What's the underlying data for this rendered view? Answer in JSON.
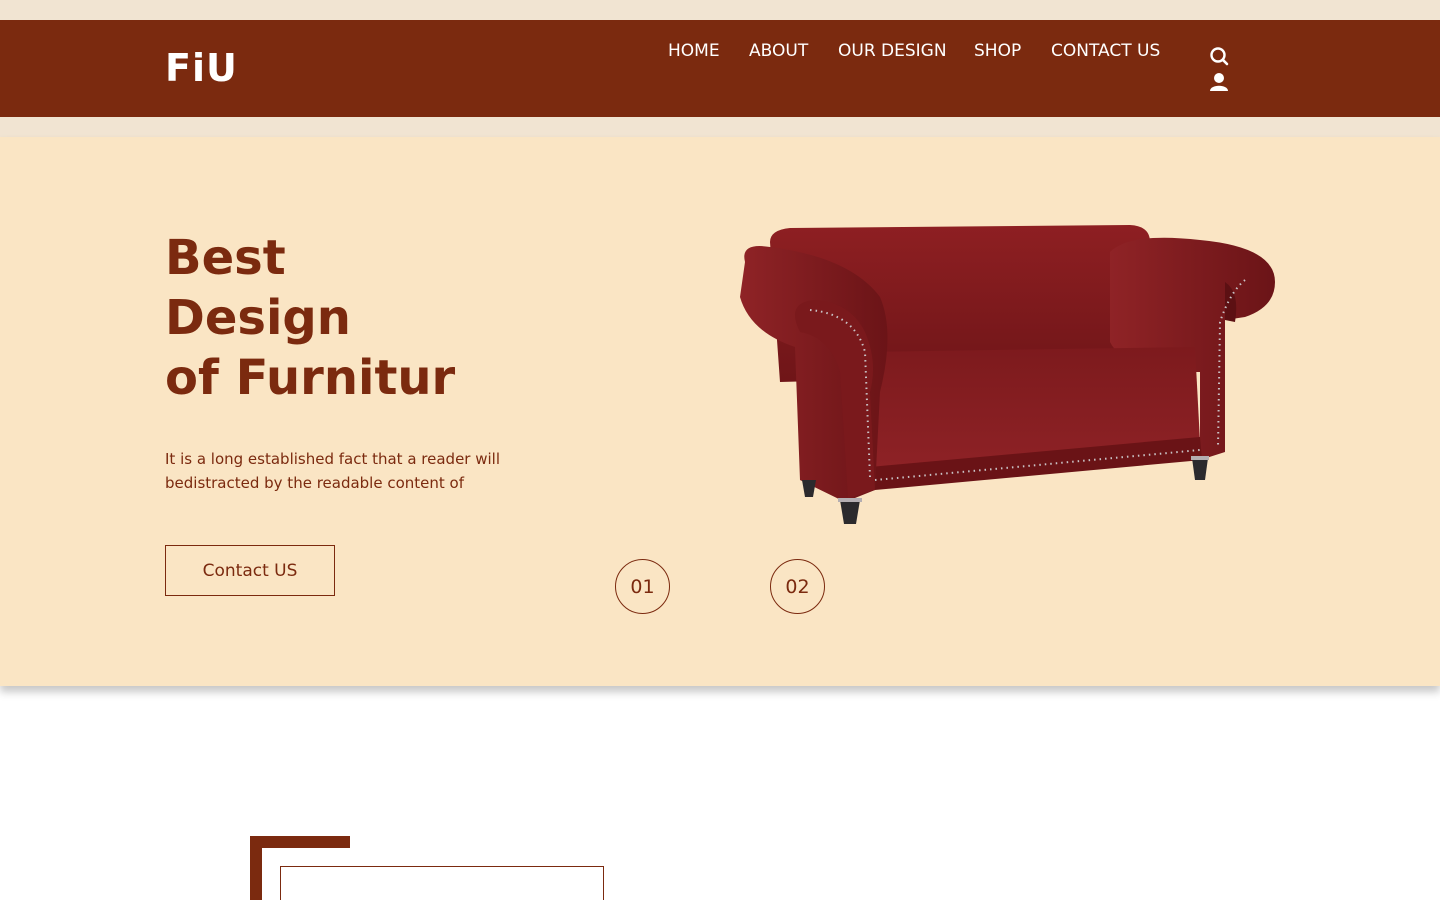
{
  "brand": {
    "logo_text": "FiU"
  },
  "nav": {
    "items": [
      {
        "label": "HOME"
      },
      {
        "label": "ABOUT"
      },
      {
        "label": "OUR DESIGN"
      },
      {
        "label": "SHOP"
      },
      {
        "label": "CONTACT US"
      }
    ]
  },
  "header_icons": [
    "search-icon",
    "user-icon"
  ],
  "hero": {
    "title_lines": [
      "Best",
      "Design",
      "of Furnitur"
    ],
    "description": "It is a long established fact that a reader will bedistracted by the readable content of",
    "button_label": "Contact US",
    "slides": [
      "01",
      "02"
    ]
  },
  "colors": {
    "brand": "#7b2a0f",
    "hero_bg": "#fae5c4",
    "strip": "#f1e4d2",
    "sofa": "#8e1f22"
  }
}
